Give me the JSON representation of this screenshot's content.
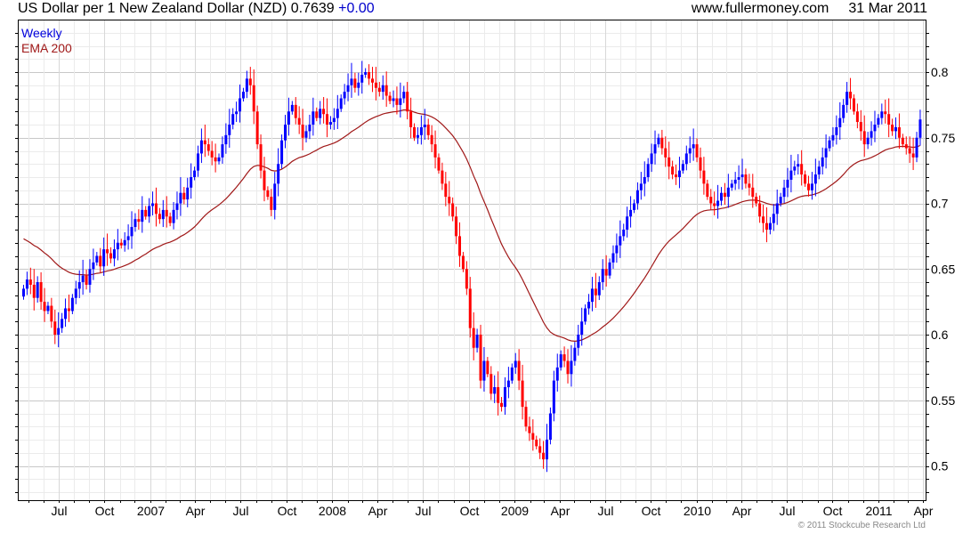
{
  "header": {
    "title": "US Dollar per 1 New Zealand Dollar (NZD) 0.7639",
    "change": "+0.00",
    "site": "www.fullermoney.com",
    "date": "31 Mar 2011"
  },
  "footer": {
    "copyright": "© 2011 Stockcube Research Ltd"
  },
  "chart_data": {
    "type": "candlestick",
    "title": "US Dollar per 1 New Zealand Dollar (NZD)",
    "last_value": 0.7639,
    "legend": [
      {
        "name": "Weekly",
        "color": "#0000dd"
      },
      {
        "name": "EMA 200",
        "color": "#a01818"
      }
    ],
    "legend_position": "top-left",
    "colors": {
      "up": "#0000ff",
      "down": "#ff0000",
      "ema": "#a01818",
      "grid_major": "#c8c8c8",
      "grid_minor": "#ebebeb"
    },
    "ylim": [
      0.474,
      0.84
    ],
    "y_ticks": [
      "0.5",
      "0.55",
      "0.6",
      "0.65",
      "0.7",
      "0.75",
      "0.8"
    ],
    "x_ticks": [
      "Jul",
      "Oct",
      "2007",
      "Apr",
      "Jul",
      "Oct",
      "2008",
      "Apr",
      "Jul",
      "Oct",
      "2009",
      "Apr",
      "Jul",
      "Oct",
      "2010",
      "Apr",
      "Jul",
      "Oct",
      "2011",
      "Apr"
    ],
    "y_axis_side": "right",
    "grid": true,
    "weekly_close": [
      0.635,
      0.642,
      0.638,
      0.628,
      0.64,
      0.625,
      0.618,
      0.622,
      0.61,
      0.6,
      0.605,
      0.612,
      0.62,
      0.618,
      0.628,
      0.635,
      0.64,
      0.645,
      0.638,
      0.65,
      0.655,
      0.66,
      0.652,
      0.665,
      0.662,
      0.658,
      0.665,
      0.67,
      0.668,
      0.672,
      0.675,
      0.682,
      0.688,
      0.686,
      0.695,
      0.69,
      0.698,
      0.7,
      0.692,
      0.688,
      0.695,
      0.69,
      0.685,
      0.695,
      0.7,
      0.708,
      0.703,
      0.712,
      0.72,
      0.725,
      0.738,
      0.748,
      0.745,
      0.74,
      0.735,
      0.732,
      0.735,
      0.745,
      0.752,
      0.76,
      0.768,
      0.77,
      0.78,
      0.785,
      0.795,
      0.79,
      0.77,
      0.745,
      0.725,
      0.71,
      0.705,
      0.695,
      0.715,
      0.73,
      0.748,
      0.76,
      0.77,
      0.775,
      0.765,
      0.76,
      0.75,
      0.755,
      0.76,
      0.77,
      0.765,
      0.772,
      0.768,
      0.76,
      0.762,
      0.765,
      0.772,
      0.78,
      0.785,
      0.79,
      0.795,
      0.788,
      0.792,
      0.798,
      0.8,
      0.795,
      0.792,
      0.788,
      0.785,
      0.79,
      0.782,
      0.778,
      0.78,
      0.775,
      0.78,
      0.785,
      0.77,
      0.758,
      0.75,
      0.752,
      0.758,
      0.76,
      0.752,
      0.745,
      0.735,
      0.725,
      0.715,
      0.705,
      0.7,
      0.69,
      0.675,
      0.66,
      0.65,
      0.635,
      0.605,
      0.59,
      0.6,
      0.565,
      0.58,
      0.57,
      0.555,
      0.56,
      0.548,
      0.545,
      0.56,
      0.565,
      0.575,
      0.58,
      0.565,
      0.545,
      0.53,
      0.525,
      0.52,
      0.515,
      0.51,
      0.505,
      0.52,
      0.54,
      0.565,
      0.575,
      0.585,
      0.58,
      0.57,
      0.58,
      0.59,
      0.6,
      0.61,
      0.62,
      0.625,
      0.635,
      0.63,
      0.64,
      0.65,
      0.645,
      0.655,
      0.662,
      0.668,
      0.675,
      0.68,
      0.69,
      0.695,
      0.7,
      0.71,
      0.715,
      0.72,
      0.73,
      0.738,
      0.745,
      0.75,
      0.742,
      0.735,
      0.728,
      0.722,
      0.72,
      0.725,
      0.73,
      0.738,
      0.742,
      0.745,
      0.735,
      0.725,
      0.715,
      0.705,
      0.7,
      0.698,
      0.702,
      0.708,
      0.705,
      0.712,
      0.715,
      0.718,
      0.72,
      0.722,
      0.715,
      0.712,
      0.705,
      0.7,
      0.69,
      0.685,
      0.68,
      0.685,
      0.692,
      0.7,
      0.705,
      0.712,
      0.718,
      0.725,
      0.728,
      0.73,
      0.722,
      0.715,
      0.71,
      0.715,
      0.722,
      0.728,
      0.735,
      0.742,
      0.748,
      0.752,
      0.758,
      0.765,
      0.775,
      0.785,
      0.78,
      0.77,
      0.762,
      0.755,
      0.745,
      0.75,
      0.755,
      0.76,
      0.765,
      0.77,
      0.768,
      0.76,
      0.755,
      0.758,
      0.75,
      0.745,
      0.742,
      0.738,
      0.735,
      0.75,
      0.7639
    ]
  }
}
